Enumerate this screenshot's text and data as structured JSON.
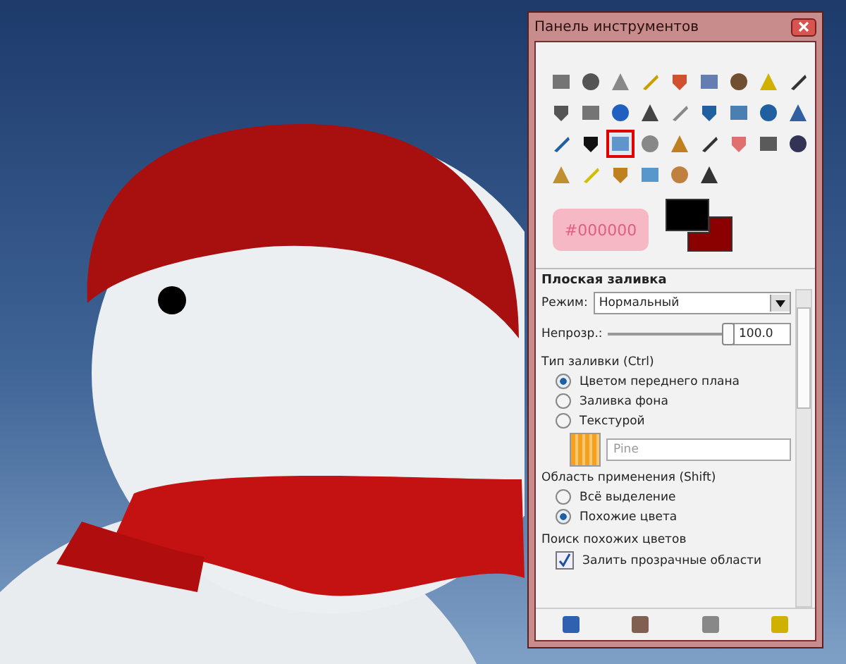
{
  "window": {
    "title": "Панель инструментов"
  },
  "tools": [
    {
      "selected": false
    },
    {
      "selected": false
    },
    {
      "selected": false
    },
    {
      "selected": false
    },
    {
      "selected": false
    },
    {
      "selected": false
    },
    {
      "selected": false
    },
    {
      "selected": false
    },
    {
      "selected": false
    },
    {
      "selected": false
    },
    {
      "selected": false
    },
    {
      "selected": false
    },
    {
      "selected": false
    },
    {
      "selected": false
    },
    {
      "selected": false
    },
    {
      "selected": false
    },
    {
      "selected": false
    },
    {
      "selected": false
    },
    {
      "selected": false
    },
    {
      "selected": false
    },
    {
      "selected": true
    },
    {
      "selected": false
    },
    {
      "selected": false
    },
    {
      "selected": false
    },
    {
      "selected": false
    },
    {
      "selected": false
    },
    {
      "selected": false
    },
    {
      "selected": false
    },
    {
      "selected": false
    },
    {
      "selected": false
    },
    {
      "selected": false
    },
    {
      "selected": false
    },
    {
      "selected": false
    }
  ],
  "tooltip": {
    "text": "#000000"
  },
  "color_swatches": [
    {
      "kind": "foreground",
      "color": "#000000"
    },
    {
      "kind": "background",
      "color": "#8b0000"
    }
  ],
  "options": {
    "title": "Плоская заливка",
    "mode": {
      "label": "Режим:",
      "value": "Нормальный"
    },
    "opacity": {
      "label": "Непрозр.:",
      "level": 1.0,
      "value": "100.0"
    },
    "fill_type": {
      "label": "Тип заливки (Ctrl)",
      "options": [
        {
          "label": "Цветом переднего плана",
          "selected": true
        },
        {
          "label": "Заливка фона",
          "selected": false
        },
        {
          "label": "Текстурой",
          "selected": false
        }
      ],
      "pattern": "Pine"
    },
    "affected_area": {
      "label": "Область применения (Shift)",
      "options": [
        {
          "label": "Всё выделение",
          "selected": false
        },
        {
          "label": "Похожие цвета",
          "selected": true
        }
      ]
    },
    "finding": {
      "label": "Поиск похожих цветов",
      "checkbox": {
        "label": "Залить прозрачные области",
        "checked": true
      }
    }
  }
}
